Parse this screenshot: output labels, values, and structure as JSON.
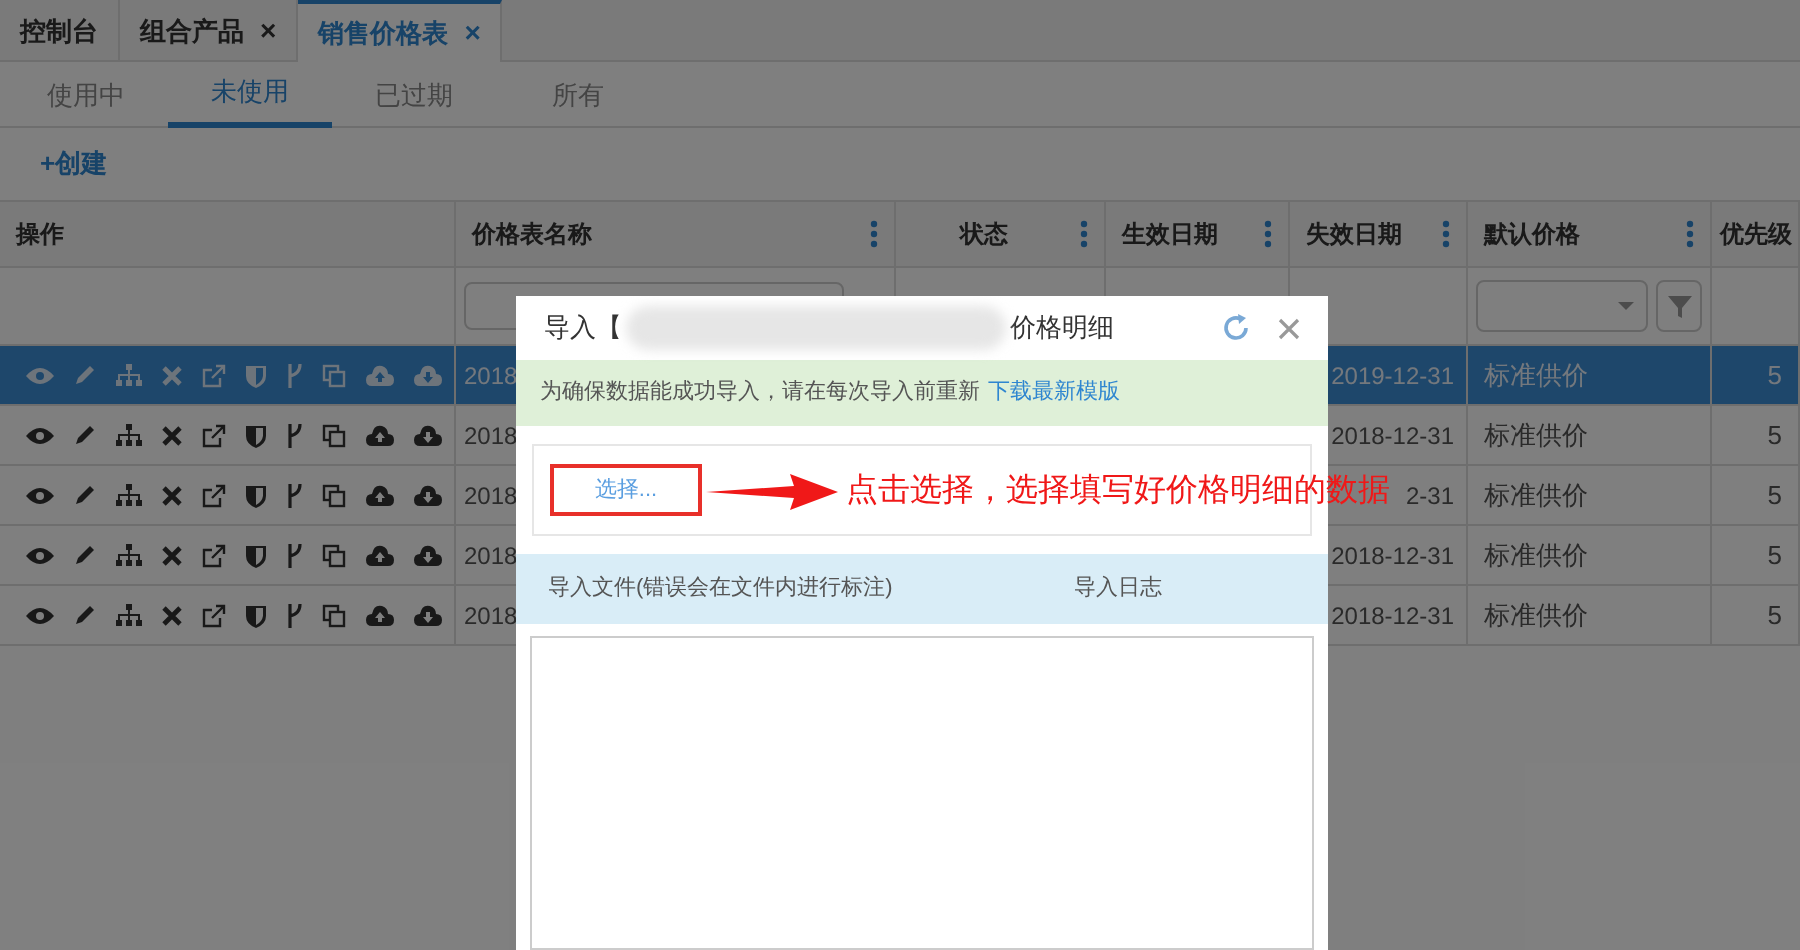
{
  "tabs": [
    {
      "label": "控制台",
      "closable": false,
      "selected": false
    },
    {
      "label": "组合产品",
      "closable": true,
      "selected": false
    },
    {
      "label": "销售价格表",
      "closable": true,
      "selected": true
    }
  ],
  "close_glyph": "×",
  "subtabs": [
    {
      "label": "使用中",
      "selected": false
    },
    {
      "label": "未使用",
      "selected": true
    },
    {
      "label": "已过期",
      "selected": false
    },
    {
      "label": "所有",
      "selected": false
    }
  ],
  "create_button": "+创建",
  "table": {
    "columns": [
      {
        "label": "操作",
        "menu": false
      },
      {
        "label": "价格表名称",
        "menu": true
      },
      {
        "label": "状态",
        "menu": true
      },
      {
        "label": "生效日期",
        "menu": true
      },
      {
        "label": "失效日期",
        "menu": true
      },
      {
        "label": "默认价格",
        "menu": true
      },
      {
        "label": "优先级",
        "menu": false
      }
    ],
    "rows": [
      {
        "selected": true,
        "name": "2018",
        "end_date": "2019-12-31",
        "default_price": "标准供价",
        "priority": "5"
      },
      {
        "selected": false,
        "name": "2018",
        "end_date": "2018-12-31",
        "default_price": "标准供价",
        "priority": "5"
      },
      {
        "selected": false,
        "name": "2018",
        "end_date": "2-31",
        "default_price": "标准供价",
        "priority": "5"
      },
      {
        "selected": false,
        "name": "2018",
        "end_date": "2018-12-31",
        "default_price": "标准供价",
        "priority": "5"
      },
      {
        "selected": false,
        "name": "2018",
        "end_date": "2018-12-31",
        "default_price": "标准供价",
        "priority": "5"
      }
    ]
  },
  "dialog": {
    "title_start": "导入【",
    "title_end": "价格明细",
    "notice": "为确保数据能成功导入，请在每次导入前重新",
    "notice_link": "下载最新模版",
    "select_button": "选择...",
    "columns": [
      "导入文件(错误会在文件内进行标注)",
      "导入日志"
    ]
  },
  "annotation": "点击选择，选择填写好价格明细的数据"
}
